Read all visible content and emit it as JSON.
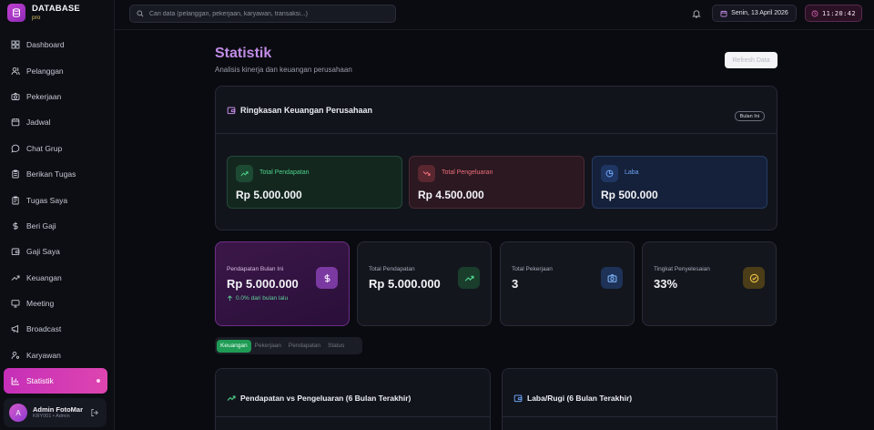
{
  "brand": {
    "name": "DATABASE",
    "sub": "pro"
  },
  "sidebar": {
    "items": [
      {
        "label": "Dashboard",
        "icon": "grid-icon"
      },
      {
        "label": "Pelanggan",
        "icon": "users-icon"
      },
      {
        "label": "Pekerjaan",
        "icon": "camera-icon"
      },
      {
        "label": "Jadwal",
        "icon": "calendar-icon"
      },
      {
        "label": "Chat Grup",
        "icon": "chat-icon"
      },
      {
        "label": "Berikan Tugas",
        "icon": "clipboard-icon"
      },
      {
        "label": "Tugas Saya",
        "icon": "clipboard-list-icon"
      },
      {
        "label": "Beri Gaji",
        "icon": "dollar-icon"
      },
      {
        "label": "Gaji Saya",
        "icon": "wallet-icon"
      },
      {
        "label": "Keuangan",
        "icon": "trend-icon"
      },
      {
        "label": "Meeting",
        "icon": "video-icon"
      },
      {
        "label": "Broadcast",
        "icon": "megaphone-icon"
      },
      {
        "label": "Karyawan",
        "icon": "user-cog-icon"
      },
      {
        "label": "Statistik",
        "icon": "bar-chart-icon",
        "active": true
      }
    ]
  },
  "user": {
    "initial": "A",
    "name": "Admin FotoMar",
    "role": "KRY001 • Admin"
  },
  "topbar": {
    "search_placeholder": "Cari data (pelanggan, pekerjaan, karyawan, transaksi...)",
    "date": "Senin, 13 April 2026",
    "time": "11:20:42"
  },
  "page": {
    "title": "Statistik",
    "subtitle": "Analisis kinerja dan keuangan perusahaan",
    "refresh_label": "Refresh Data"
  },
  "summary": {
    "title": "Ringkasan Keuangan Perusahaan",
    "period": "Bulan Ini",
    "income_label": "Total Pendapatan",
    "income_value": "Rp 5.000.000",
    "expense_label": "Total Pengeluaran",
    "expense_value": "Rp 4.500.000",
    "profit_label": "Laba",
    "profit_value": "Rp 500.000"
  },
  "stats": {
    "month_income_label": "Pendapatan Bulan Ini",
    "month_income_value": "Rp 5.000.000",
    "month_income_growth": "0.0% dari bulan lalu",
    "total_income_label": "Total Pendapatan",
    "total_income_value": "Rp 5.000.000",
    "total_jobs_label": "Total Pekerjaan",
    "total_jobs_value": "3",
    "completion_label": "Tingkat Penyelesaian",
    "completion_value": "33%"
  },
  "tabs": [
    "Keuangan",
    "Pekerjaan",
    "Pendapatan",
    "Status"
  ],
  "charts": {
    "left_title": "Pendapatan vs Pengeluaran (6 Bulan Terakhir)",
    "right_title": "Laba/Rugi (6 Bulan Terakhir)"
  },
  "colors": {
    "accent": "#c52fb8",
    "title": "#c18ce6",
    "success": "#1f9b55"
  }
}
